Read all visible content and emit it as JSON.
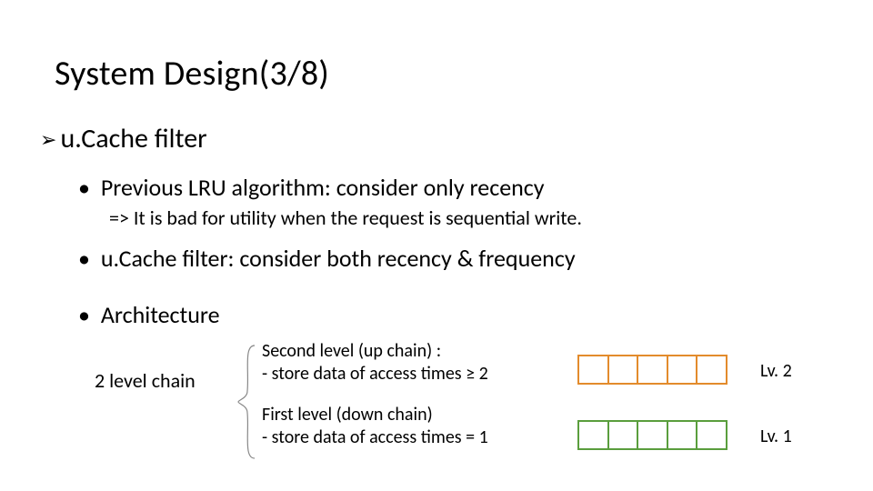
{
  "title": "System Design(3/8)",
  "section": {
    "label": "u.Cache filter"
  },
  "bullets": {
    "b1": "Previous LRU algorithm: consider only recency",
    "sub": "=> It is bad for utility  when the request is sequential write.",
    "b2": "u.Cache filter: consider both recency & frequency",
    "b3": "Architecture"
  },
  "chain_label": "2 level chain",
  "up_chain": {
    "line1": "Second level (up chain) :",
    "line2": "- store data of access times ≥ 2",
    "level_label": "Lv. 2",
    "cells": 5,
    "color": "#e38b2c"
  },
  "down_chain": {
    "line1": "First level (down chain)",
    "line2": "- store data of access times = 1",
    "level_label": "Lv. 1",
    "cells": 5,
    "color": "#5a9e3d"
  }
}
